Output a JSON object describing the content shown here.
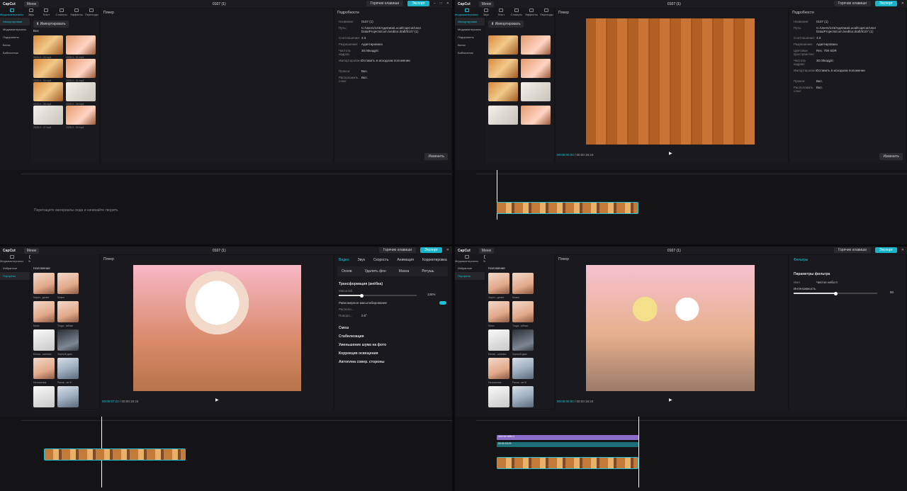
{
  "app": {
    "logo": "CapCut",
    "menu": "Меню",
    "project": "0107 (1)",
    "hotkeys": "Горячие клавиши",
    "export": "Экспорт"
  },
  "toolbar": [
    "Медиаматериалы",
    "Звук",
    "Текст",
    "Стикеры",
    "Эффекты",
    "Переходы"
  ],
  "q1": {
    "nav": [
      "Импортирован",
      "Медиаматериалы",
      "Подпроекты",
      "Взнос",
      "Библиотека"
    ],
    "import": "Импортировать",
    "all": "Все",
    "thumbs": [
      "2025-0...24.mp4",
      "2025-0...01.mp4",
      "2025-0...04.mp4",
      "2025-0...01.mp4",
      "2025-0...36.mp4",
      "2025-0...34.mp4",
      "2025-0...27.mp4",
      "2025-0...02.mp4"
    ],
    "player": "Плеер",
    "props_title": "Подробности",
    "props": [
      [
        "Название:",
        "0107 (1)"
      ],
      [
        "Путь:",
        "C:/Users/123/AppData/Local/CapCut/User Data/Projects/com.lveditor.draft/0107 (1)"
      ],
      [
        "Соотношение:",
        "4:3"
      ],
      [
        "Разрешение:",
        "Адаптировано"
      ],
      [
        "Частота кадров:",
        "30.00кадр/с"
      ],
      [
        "Импортировано:",
        "Оставить в исходном положении"
      ],
      [
        "Прокси:",
        "Вкл."
      ],
      [
        "Расположить слои:",
        "Вкл."
      ]
    ],
    "change": "Изменить",
    "hint": "Перетащите материалы сюда и начинайте творить"
  },
  "q2": {
    "time": "00:00:00:00",
    "dur": "00:00:18:24",
    "props": [
      [
        "Название:",
        "0107 (1)"
      ],
      [
        "Путь:",
        "C:/Users/123/AppData/Local/CapCut/User Data/Projects/com.lveditor.draft/0107 (1)"
      ],
      [
        "Соотношение:",
        "4:3"
      ],
      [
        "Разрешение:",
        "Адаптировано"
      ],
      [
        "Цветовое пространство:",
        "Rec. 709 SDR"
      ],
      [
        "Частота кадров:",
        "30.00кадр/с"
      ],
      [
        "Импортировано:",
        "Оставить в исходном положении"
      ],
      [
        "Прокси:",
        "Вкл."
      ],
      [
        "Расположить слои:",
        "Вкл."
      ]
    ]
  },
  "q3": {
    "nav": [
      "Избранное",
      "Портреты"
    ],
    "section": "Наложение",
    "filters": [
      "Через...донее",
      "Мокко",
      "Монс",
      "Тогда...юбнан",
      "Белая...шинная",
      "Черный дым",
      "Наложение",
      "Рассв...ие III",
      "Белый дым",
      "Рассвет"
    ],
    "tabs": [
      "Видео",
      "Звук",
      "Скорость",
      "Анимация",
      "Корректировка"
    ],
    "subtabs": [
      "Основ",
      "Удалить фон",
      "Маска",
      "Ретушь"
    ],
    "transform": "Трансформация (анёбка)",
    "scale_label": "Масштаб",
    "scale_val": "134%",
    "uniform": "Равномерное масштабирование",
    "pos": "Располо...",
    "rot": "Поворо...",
    "rot_val": "0.0°",
    "sections": [
      "Смеш",
      "Стабилизация",
      "Уменьшение шума на фото",
      "Коррекция освещения",
      "Автоплна совер. стороны"
    ],
    "time": "00:00:07:22",
    "dur": "00:00:18:24"
  },
  "q4": {
    "tab": "Фильтры",
    "params": "Параметры фильтра",
    "name_label": "Имя",
    "name_val": "Чистое небо II",
    "intensity": "Интенсивность",
    "intensity_val": "50",
    "clip1": "Чистое небо II",
    "clip2": "00:00:18:23",
    "time": "00:00:00:00",
    "dur": "00:00:18:24"
  }
}
